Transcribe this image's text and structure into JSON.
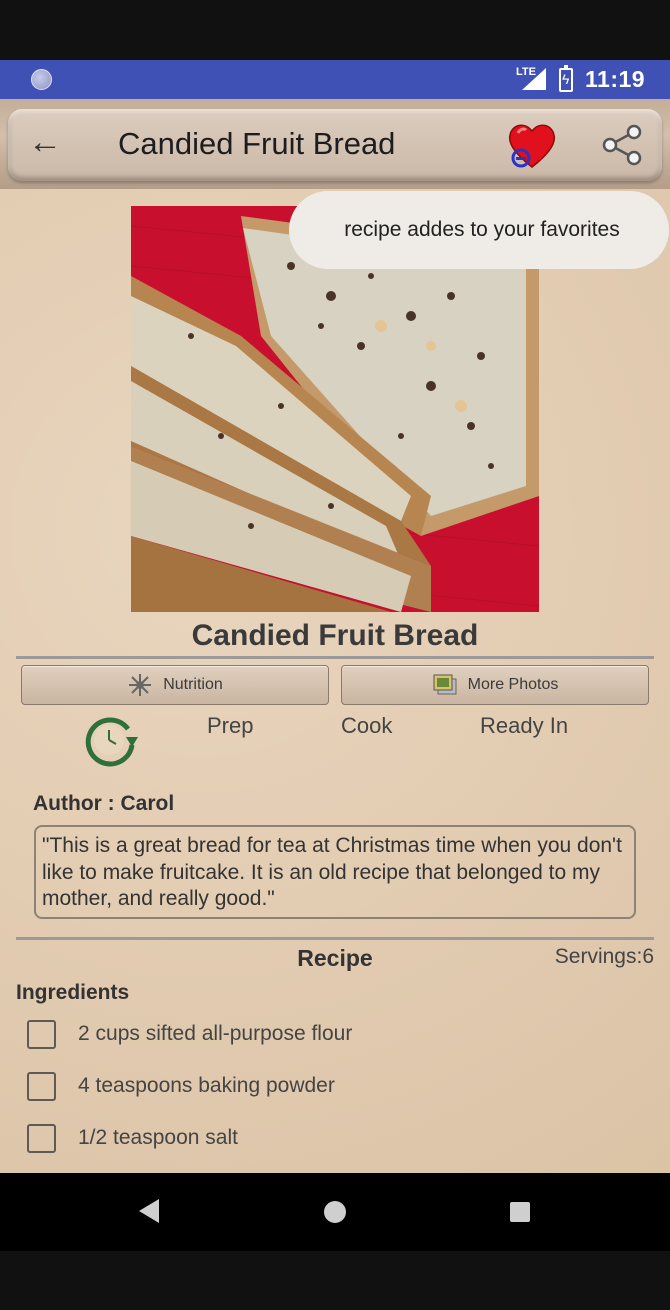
{
  "status_bar": {
    "network": "LTE",
    "time": "11:19"
  },
  "app_bar": {
    "title": "Candied Fruit Bread",
    "back_icon": "back-arrow-icon",
    "favorite_icon": "heart-icon",
    "share_icon": "share-icon"
  },
  "toast": {
    "message": "recipe addes to your favorites"
  },
  "recipe": {
    "title": "Candied Fruit Bread",
    "buttons": {
      "nutrition": "Nutrition",
      "more_photos": "More Photos"
    },
    "times": {
      "prep": "Prep",
      "cook": "Cook",
      "ready": "Ready In"
    },
    "author": "Author : Carol",
    "description": "\"This is a great bread for tea at Christmas time when you don't like to make fruitcake.  It is an old recipe that belonged to my mother, and really good.\"",
    "section_title": "Recipe",
    "servings": "Servings:6",
    "ingredients_title": "Ingredients",
    "ingredients": [
      "2 cups sifted all-purpose flour",
      "4 teaspoons baking powder",
      "1/2 teaspoon salt"
    ]
  },
  "colors": {
    "status_bar": "#3f51b5",
    "paper": "#e3cdb3",
    "heart": "#e0101c",
    "photo_cloth": "#c8102e"
  }
}
